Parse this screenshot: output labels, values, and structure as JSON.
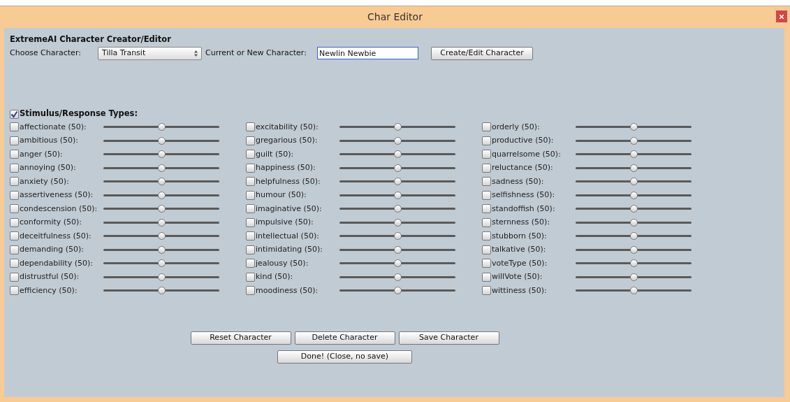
{
  "window": {
    "title": "Char Editor"
  },
  "heading": "ExtremeAI Character Creator/Editor",
  "choose_character": {
    "label": "Choose Character:",
    "value": "Tilla Transit"
  },
  "current_character": {
    "label": "Current or New Character:",
    "value": "Newlin Newbie"
  },
  "create_button": "Create/Edit Character",
  "types_section": {
    "label": "Stimulus/Response Types:",
    "checked": true
  },
  "columns": [
    [
      {
        "label": "affectionate (50):",
        "checked": false,
        "level": 0.5
      },
      {
        "label": "ambitious (50):",
        "checked": false,
        "level": 0.5
      },
      {
        "label": "anger (50):",
        "checked": false,
        "level": 0.5
      },
      {
        "label": "annoying (50):",
        "checked": false,
        "level": 0.5
      },
      {
        "label": "anxiety (50):",
        "checked": false,
        "level": 0.5
      },
      {
        "label": "assertiveness (50):",
        "checked": false,
        "level": 0.5
      },
      {
        "label": "condescension (50):",
        "checked": false,
        "level": 0.5
      },
      {
        "label": "conformity (50):",
        "checked": false,
        "level": 0.5
      },
      {
        "label": "deceitfulness (50):",
        "checked": false,
        "level": 0.5
      },
      {
        "label": "demanding (50):",
        "checked": false,
        "level": 0.5
      },
      {
        "label": "dependability (50):",
        "checked": false,
        "level": 0.5
      },
      {
        "label": "distrustful (50):",
        "checked": false,
        "level": 0.5
      },
      {
        "label": "efficiency (50):",
        "checked": false,
        "level": 0.5
      }
    ],
    [
      {
        "label": "excitability (50):",
        "checked": false,
        "level": 0.5
      },
      {
        "label": "gregarious (50):",
        "checked": false,
        "level": 0.5
      },
      {
        "label": "guilt (50):",
        "checked": false,
        "level": 0.5
      },
      {
        "label": "happiness (50):",
        "checked": false,
        "level": 0.5
      },
      {
        "label": "helpfulness (50):",
        "checked": false,
        "level": 0.5
      },
      {
        "label": "humour (50):",
        "checked": false,
        "level": 0.5
      },
      {
        "label": "imaginative (50):",
        "checked": false,
        "level": 0.5
      },
      {
        "label": "impulsive (50):",
        "checked": false,
        "level": 0.5
      },
      {
        "label": "intellectual (50):",
        "checked": false,
        "level": 0.5
      },
      {
        "label": "intimidating (50):",
        "checked": false,
        "level": 0.5
      },
      {
        "label": "jealousy (50):",
        "checked": false,
        "level": 0.5
      },
      {
        "label": "kind (50):",
        "checked": false,
        "level": 0.5
      },
      {
        "label": "moodiness (50):",
        "checked": false,
        "level": 0.5
      }
    ],
    [
      {
        "label": "orderly (50):",
        "checked": false,
        "level": 0.5
      },
      {
        "label": "productive (50):",
        "checked": false,
        "level": 0.5
      },
      {
        "label": "quarrelsome (50):",
        "checked": false,
        "level": 0.5
      },
      {
        "label": "reluctance (50):",
        "checked": false,
        "level": 0.5
      },
      {
        "label": "sadness (50):",
        "checked": false,
        "level": 0.5
      },
      {
        "label": "selfishness (50):",
        "checked": false,
        "level": 0.5
      },
      {
        "label": "standoffish (50):",
        "checked": false,
        "level": 0.5
      },
      {
        "label": "sternness (50):",
        "checked": false,
        "level": 0.5
      },
      {
        "label": "stubborn (50):",
        "checked": false,
        "level": 0.5
      },
      {
        "label": "talkative (50):",
        "checked": false,
        "level": 0.5
      },
      {
        "label": "voteType (50):",
        "checked": false,
        "level": 0.5
      },
      {
        "label": "willVote (50):",
        "checked": false,
        "level": 0.5
      },
      {
        "label": "wittiness (50):",
        "checked": false,
        "level": 0.5
      }
    ]
  ],
  "buttons": [
    "Reset Character",
    "Delete Character",
    "Save Character"
  ],
  "done_button": "Done! (Close, no save)"
}
